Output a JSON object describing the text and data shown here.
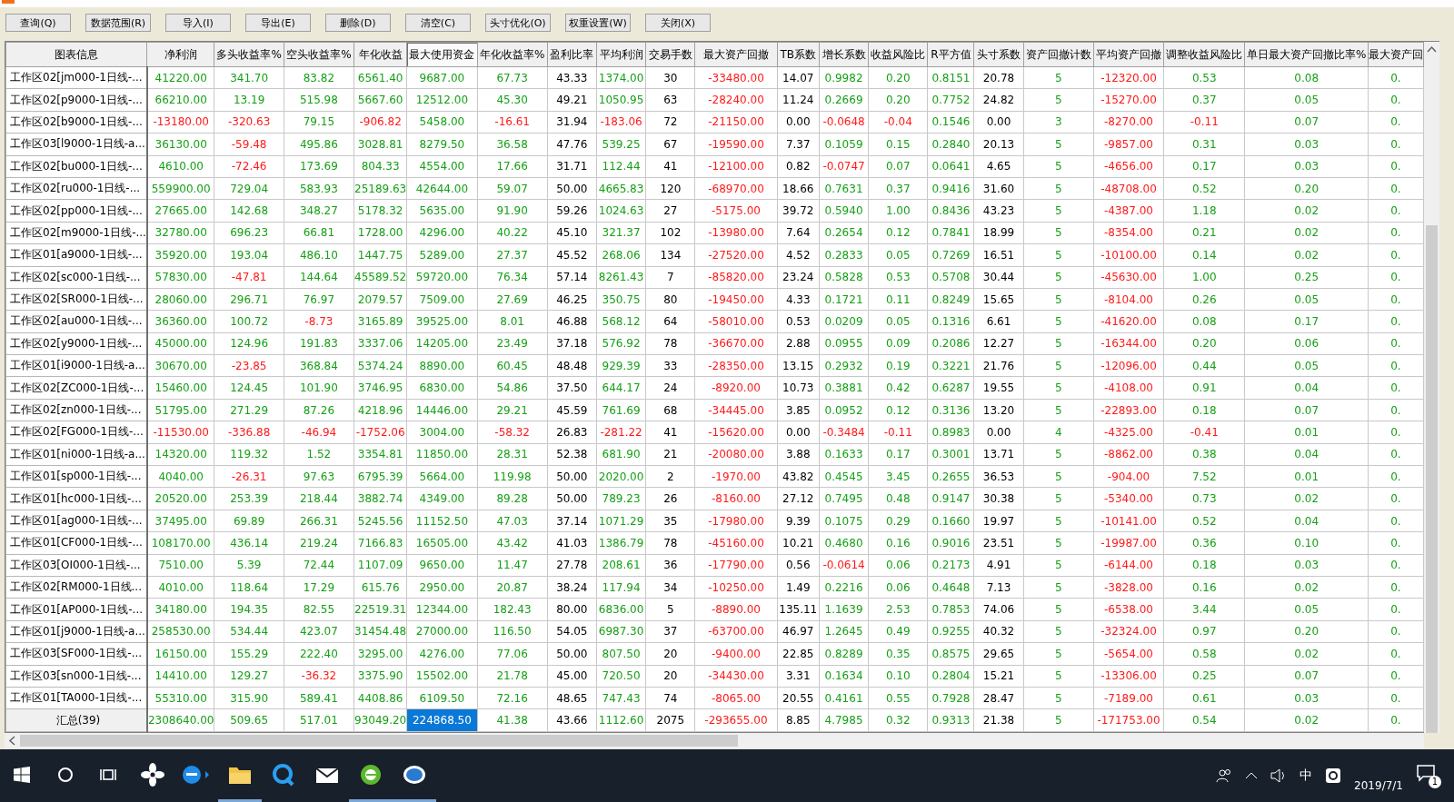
{
  "toolbar": {
    "buttons": [
      "查询(Q)",
      "数据范围(R)",
      "导入(I)",
      "导出(E)",
      "删除(D)",
      "清空(C)",
      "头寸优化(O)",
      "权重设置(W)",
      "关闭(X)"
    ]
  },
  "table": {
    "columns": [
      {
        "label": "图表信息",
        "kind": "label",
        "selected": false
      },
      {
        "label": "净利润",
        "kind": "signed",
        "selected": false
      },
      {
        "label": "多头收益率%",
        "kind": "signed",
        "selected": false
      },
      {
        "label": "空头收益率%",
        "kind": "signed",
        "selected": false
      },
      {
        "label": "年化收益",
        "kind": "signed",
        "selected": false
      },
      {
        "label": "最大使用资金",
        "kind": "signed",
        "selected": true
      },
      {
        "label": "年化收益率%",
        "kind": "signed",
        "selected": false
      },
      {
        "label": "盈利比率",
        "kind": "plain",
        "selected": false
      },
      {
        "label": "平均利润",
        "kind": "signed",
        "selected": false
      },
      {
        "label": "交易手数",
        "kind": "plain",
        "selected": false
      },
      {
        "label": "最大资产回撤",
        "kind": "signed",
        "selected": false
      },
      {
        "label": "TB系数",
        "kind": "plain",
        "selected": false
      },
      {
        "label": "增长系数",
        "kind": "signed",
        "selected": false
      },
      {
        "label": "收益风险比",
        "kind": "signed",
        "selected": false
      },
      {
        "label": "R平方值",
        "kind": "signed",
        "selected": false
      },
      {
        "label": "头寸系数",
        "kind": "plain",
        "selected": false
      },
      {
        "label": "资产回撤计数",
        "kind": "signed",
        "selected": false
      },
      {
        "label": "平均资产回撤",
        "kind": "signed",
        "selected": false
      },
      {
        "label": "调整收益风险比",
        "kind": "signed",
        "selected": false
      },
      {
        "label": "单日最大资产回撤比率%",
        "kind": "signed",
        "selected": false
      },
      {
        "label": "最大资产回",
        "kind": "signed",
        "selected": false
      }
    ],
    "rows": [
      [
        "工作区02[jm000-1日线-...",
        "41220.00",
        "341.70",
        "83.82",
        "6561.40",
        "9687.00",
        "67.73",
        "43.33",
        "1374.00",
        "30",
        "-33480.00",
        "14.07",
        "0.9982",
        "0.20",
        "0.8151",
        "20.78",
        "5",
        "-12320.00",
        "0.53",
        "0.08",
        "0."
      ],
      [
        "工作区02[p9000-1日线-...",
        "66210.00",
        "13.19",
        "515.98",
        "5667.60",
        "12512.00",
        "45.30",
        "49.21",
        "1050.95",
        "63",
        "-28240.00",
        "11.24",
        "0.2669",
        "0.20",
        "0.7752",
        "24.82",
        "5",
        "-15270.00",
        "0.37",
        "0.05",
        "0."
      ],
      [
        "工作区02[b9000-1日线-...",
        "-13180.00",
        "-320.63",
        "79.15",
        "-906.82",
        "5458.00",
        "-16.61",
        "31.94",
        "-183.06",
        "72",
        "-21150.00",
        "0.00",
        "-0.0648",
        "-0.04",
        "0.1546",
        "0.00",
        "3",
        "-8270.00",
        "-0.11",
        "0.07",
        "0."
      ],
      [
        "工作区03[l9000-1日线-a...",
        "36130.00",
        "-59.48",
        "495.86",
        "3028.81",
        "8279.50",
        "36.58",
        "47.76",
        "539.25",
        "67",
        "-19590.00",
        "7.37",
        "0.1059",
        "0.15",
        "0.2840",
        "20.13",
        "5",
        "-9857.00",
        "0.31",
        "0.03",
        "0."
      ],
      [
        "工作区02[bu000-1日线-...",
        "4610.00",
        "-72.46",
        "173.69",
        "804.33",
        "4554.00",
        "17.66",
        "31.71",
        "112.44",
        "41",
        "-12100.00",
        "0.82",
        "-0.0747",
        "0.07",
        "0.0641",
        "4.65",
        "5",
        "-4656.00",
        "0.17",
        "0.03",
        "0."
      ],
      [
        "工作区02[ru000-1日线-...",
        "559900.00",
        "729.04",
        "583.93",
        "25189.63",
        "42644.00",
        "59.07",
        "50.00",
        "4665.83",
        "120",
        "-68970.00",
        "18.66",
        "0.7631",
        "0.37",
        "0.9416",
        "31.60",
        "5",
        "-48708.00",
        "0.52",
        "0.20",
        "0."
      ],
      [
        "工作区02[pp000-1日线-...",
        "27665.00",
        "142.68",
        "348.27",
        "5178.32",
        "5635.00",
        "91.90",
        "59.26",
        "1024.63",
        "27",
        "-5175.00",
        "39.72",
        "0.5940",
        "1.00",
        "0.8436",
        "43.23",
        "5",
        "-4387.00",
        "1.18",
        "0.02",
        "0."
      ],
      [
        "工作区02[m9000-1日线-...",
        "32780.00",
        "696.23",
        "66.81",
        "1728.00",
        "4296.00",
        "40.22",
        "45.10",
        "321.37",
        "102",
        "-13980.00",
        "7.64",
        "0.2654",
        "0.12",
        "0.7841",
        "18.99",
        "5",
        "-8354.00",
        "0.21",
        "0.02",
        "0."
      ],
      [
        "工作区01[a9000-1日线-...",
        "35920.00",
        "193.04",
        "486.10",
        "1447.75",
        "5289.00",
        "27.37",
        "45.52",
        "268.06",
        "134",
        "-27520.00",
        "4.52",
        "0.2833",
        "0.05",
        "0.7269",
        "16.51",
        "5",
        "-10100.00",
        "0.14",
        "0.02",
        "0."
      ],
      [
        "工作区02[sc000-1日线-...",
        "57830.00",
        "-47.81",
        "144.64",
        "45589.52",
        "59720.00",
        "76.34",
        "57.14",
        "8261.43",
        "7",
        "-85820.00",
        "23.24",
        "0.5828",
        "0.53",
        "0.5708",
        "30.44",
        "5",
        "-45630.00",
        "1.00",
        "0.25",
        "0."
      ],
      [
        "工作区02[SR000-1日线-...",
        "28060.00",
        "296.71",
        "76.97",
        "2079.57",
        "7509.00",
        "27.69",
        "46.25",
        "350.75",
        "80",
        "-19450.00",
        "4.33",
        "0.1721",
        "0.11",
        "0.8249",
        "15.65",
        "5",
        "-8104.00",
        "0.26",
        "0.05",
        "0."
      ],
      [
        "工作区02[au000-1日线-...",
        "36360.00",
        "100.72",
        "-8.73",
        "3165.89",
        "39525.00",
        "8.01",
        "46.88",
        "568.12",
        "64",
        "-58010.00",
        "0.53",
        "0.0209",
        "0.05",
        "0.1316",
        "6.61",
        "5",
        "-41620.00",
        "0.08",
        "0.17",
        "0."
      ],
      [
        "工作区02[y9000-1日线-...",
        "45000.00",
        "124.96",
        "191.83",
        "3337.06",
        "14205.00",
        "23.49",
        "37.18",
        "576.92",
        "78",
        "-36670.00",
        "2.88",
        "0.0955",
        "0.09",
        "0.2086",
        "12.27",
        "5",
        "-16344.00",
        "0.20",
        "0.06",
        "0."
      ],
      [
        "工作区01[i9000-1日线-a...",
        "30670.00",
        "-23.85",
        "368.84",
        "5374.24",
        "8890.00",
        "60.45",
        "48.48",
        "929.39",
        "33",
        "-28350.00",
        "13.15",
        "0.2932",
        "0.19",
        "0.3221",
        "21.76",
        "5",
        "-12096.00",
        "0.44",
        "0.05",
        "0."
      ],
      [
        "工作区02[ZC000-1日线-...",
        "15460.00",
        "124.45",
        "101.90",
        "3746.95",
        "6830.00",
        "54.86",
        "37.50",
        "644.17",
        "24",
        "-8920.00",
        "10.73",
        "0.3881",
        "0.42",
        "0.6287",
        "19.55",
        "5",
        "-4108.00",
        "0.91",
        "0.04",
        "0."
      ],
      [
        "工作区02[zn000-1日线-...",
        "51795.00",
        "271.29",
        "87.26",
        "4218.96",
        "14446.00",
        "29.21",
        "45.59",
        "761.69",
        "68",
        "-34445.00",
        "3.85",
        "0.0952",
        "0.12",
        "0.3136",
        "13.20",
        "5",
        "-22893.00",
        "0.18",
        "0.07",
        "0."
      ],
      [
        "工作区02[FG000-1日线-...",
        "-11530.00",
        "-336.88",
        "-46.94",
        "-1752.06",
        "3004.00",
        "-58.32",
        "26.83",
        "-281.22",
        "41",
        "-15620.00",
        "0.00",
        "-0.3484",
        "-0.11",
        "0.8983",
        "0.00",
        "4",
        "-4325.00",
        "-0.41",
        "0.01",
        "0."
      ],
      [
        "工作区01[ni000-1日线-a...",
        "14320.00",
        "119.32",
        "1.52",
        "3354.81",
        "11850.00",
        "28.31",
        "52.38",
        "681.90",
        "21",
        "-20080.00",
        "3.88",
        "0.1633",
        "0.17",
        "0.3001",
        "13.71",
        "5",
        "-8862.00",
        "0.38",
        "0.04",
        "0."
      ],
      [
        "工作区01[sp000-1日线-...",
        "4040.00",
        "-26.31",
        "97.63",
        "6795.39",
        "5664.00",
        "119.98",
        "50.00",
        "2020.00",
        "2",
        "-1970.00",
        "43.82",
        "0.4545",
        "3.45",
        "0.2655",
        "36.53",
        "5",
        "-904.00",
        "7.52",
        "0.01",
        "0."
      ],
      [
        "工作区01[hc000-1日线-...",
        "20520.00",
        "253.39",
        "218.44",
        "3882.74",
        "4349.00",
        "89.28",
        "50.00",
        "789.23",
        "26",
        "-8160.00",
        "27.12",
        "0.7495",
        "0.48",
        "0.9147",
        "30.38",
        "5",
        "-5340.00",
        "0.73",
        "0.02",
        "0."
      ],
      [
        "工作区01[ag000-1日线-...",
        "37495.00",
        "69.89",
        "266.31",
        "5245.56",
        "11152.50",
        "47.03",
        "37.14",
        "1071.29",
        "35",
        "-17980.00",
        "9.39",
        "0.1075",
        "0.29",
        "0.1660",
        "19.97",
        "5",
        "-10141.00",
        "0.52",
        "0.04",
        "0."
      ],
      [
        "工作区01[CF000-1日线-...",
        "108170.00",
        "436.14",
        "219.24",
        "7166.83",
        "16505.00",
        "43.42",
        "41.03",
        "1386.79",
        "78",
        "-45160.00",
        "10.21",
        "0.4680",
        "0.16",
        "0.9016",
        "23.51",
        "5",
        "-19987.00",
        "0.36",
        "0.10",
        "0."
      ],
      [
        "工作区03[OI000-1日线-...",
        "7510.00",
        "5.39",
        "72.44",
        "1107.09",
        "9650.00",
        "11.47",
        "27.78",
        "208.61",
        "36",
        "-17790.00",
        "0.56",
        "-0.0614",
        "0.06",
        "0.2173",
        "4.91",
        "5",
        "-6144.00",
        "0.18",
        "0.03",
        "0."
      ],
      [
        "工作区02[RM000-1日线...",
        "4010.00",
        "118.64",
        "17.29",
        "615.76",
        "2950.00",
        "20.87",
        "38.24",
        "117.94",
        "34",
        "-10250.00",
        "1.49",
        "0.2216",
        "0.06",
        "0.4648",
        "7.13",
        "5",
        "-3828.00",
        "0.16",
        "0.02",
        "0."
      ],
      [
        "工作区01[AP000-1日线-...",
        "34180.00",
        "194.35",
        "82.55",
        "22519.31",
        "12344.00",
        "182.43",
        "80.00",
        "6836.00",
        "5",
        "-8890.00",
        "135.11",
        "1.1639",
        "2.53",
        "0.7853",
        "74.06",
        "5",
        "-6538.00",
        "3.44",
        "0.05",
        "0."
      ],
      [
        "工作区01[j9000-1日线-a...",
        "258530.00",
        "534.44",
        "423.07",
        "31454.48",
        "27000.00",
        "116.50",
        "54.05",
        "6987.30",
        "37",
        "-63700.00",
        "46.97",
        "1.2645",
        "0.49",
        "0.9255",
        "40.32",
        "5",
        "-32324.00",
        "0.97",
        "0.20",
        "0."
      ],
      [
        "工作区03[SF000-1日线-...",
        "16150.00",
        "155.29",
        "222.40",
        "3295.00",
        "4276.00",
        "77.06",
        "50.00",
        "807.50",
        "20",
        "-9400.00",
        "22.85",
        "0.8289",
        "0.35",
        "0.8575",
        "29.65",
        "5",
        "-5654.00",
        "0.58",
        "0.02",
        "0."
      ],
      [
        "工作区03[sn000-1日线-...",
        "14410.00",
        "129.27",
        "-36.32",
        "3375.90",
        "15502.00",
        "21.78",
        "45.00",
        "720.50",
        "20",
        "-34430.00",
        "3.31",
        "0.1634",
        "0.10",
        "0.2804",
        "15.21",
        "5",
        "-13306.00",
        "0.25",
        "0.07",
        "0."
      ],
      [
        "工作区01[TA000-1日线-...",
        "55310.00",
        "315.90",
        "589.41",
        "4408.86",
        "6109.50",
        "72.16",
        "48.65",
        "747.43",
        "74",
        "-8065.00",
        "20.55",
        "0.4161",
        "0.55",
        "0.7928",
        "28.47",
        "5",
        "-7189.00",
        "0.61",
        "0.03",
        "0."
      ]
    ],
    "total": [
      "汇总(39)",
      "2308640.00",
      "509.65",
      "517.01",
      "93049.20",
      "224868.50",
      "41.38",
      "43.66",
      "1112.60",
      "2075",
      "-293655.00",
      "8.85",
      "4.7985",
      "0.32",
      "0.9313",
      "21.38",
      "5",
      "-171753.00",
      "0.54",
      "0.02",
      "0."
    ]
  },
  "taskbar": {
    "input_method": "中",
    "date": "2019/7/1",
    "notification_count": "1"
  }
}
